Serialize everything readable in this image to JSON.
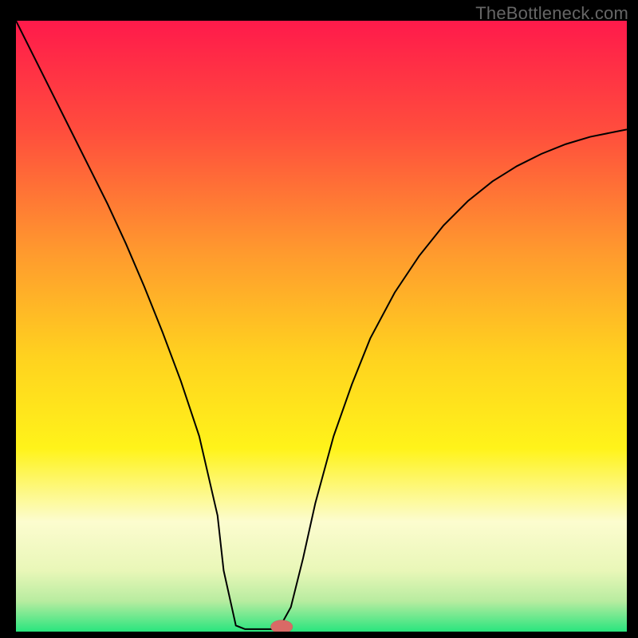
{
  "watermark": "TheBottleneck.com",
  "chart_data": {
    "type": "line",
    "title": "",
    "xlabel": "",
    "ylabel": "",
    "xlim": [
      0,
      100
    ],
    "ylim": [
      0,
      100
    ],
    "background_gradient": {
      "stops": [
        {
          "offset": 0,
          "color": "#ff1a4b"
        },
        {
          "offset": 18,
          "color": "#ff4d3d"
        },
        {
          "offset": 38,
          "color": "#ff9a2e"
        },
        {
          "offset": 55,
          "color": "#ffd21f"
        },
        {
          "offset": 70,
          "color": "#fff31a"
        },
        {
          "offset": 82,
          "color": "#fcfccf"
        },
        {
          "offset": 90,
          "color": "#e9f7b8"
        },
        {
          "offset": 95,
          "color": "#b8eca0"
        },
        {
          "offset": 100,
          "color": "#29e57e"
        }
      ]
    },
    "curve": {
      "color": "#000000",
      "width": 2,
      "x": [
        0,
        3,
        6,
        9,
        12,
        15,
        18,
        21,
        24,
        27,
        30,
        33,
        34,
        36,
        37.5,
        43,
        45,
        47,
        49,
        52,
        55,
        58,
        62,
        66,
        70,
        74,
        78,
        82,
        86,
        90,
        94,
        98,
        100
      ],
      "y": [
        100,
        94,
        88,
        82,
        76,
        70,
        63.5,
        56.5,
        49,
        41,
        32,
        19,
        10,
        1,
        0.4,
        0.4,
        4,
        12,
        21,
        32,
        40.5,
        48,
        55.5,
        61.5,
        66.5,
        70.5,
        73.7,
        76.2,
        78.2,
        79.8,
        81,
        81.8,
        82.2
      ]
    },
    "marker": {
      "x": 43.5,
      "y": 0.8,
      "rx": 1.8,
      "ry": 1.1,
      "fill": "#d96a66",
      "stroke": "#b34a46"
    }
  }
}
